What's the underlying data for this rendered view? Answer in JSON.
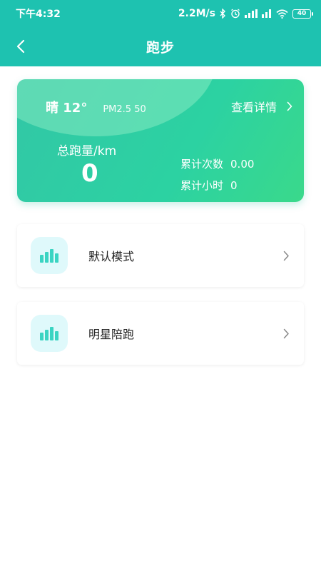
{
  "status_bar": {
    "time": "下午4:32",
    "speed": "2.2M/s",
    "battery": "40"
  },
  "nav": {
    "title": "跑步"
  },
  "summary": {
    "weather": "晴 12°",
    "pm25": "PM2.5 50",
    "detail_link": "查看详情",
    "total_label": "总跑量/km",
    "total_value": "0",
    "count_label": "累计次数",
    "count_value": "0.00",
    "hours_label": "累计小时",
    "hours_value": "0"
  },
  "modes": [
    {
      "label": "默认模式",
      "icon": "bar-chart-icon"
    },
    {
      "label": "明星陪跑",
      "icon": "bar-chart-icon"
    }
  ],
  "colors": {
    "header": "#1ec2b0",
    "card_start": "#32c7a6",
    "card_end": "#3ad98b",
    "icon_bg": "#dff9fb",
    "icon_fg": "#3ad4c2"
  }
}
